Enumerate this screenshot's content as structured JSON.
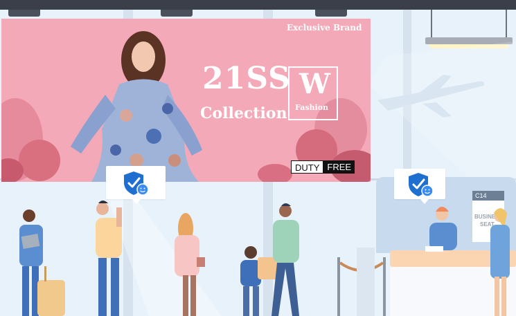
{
  "banner": {
    "brand": "Exclusive Brand",
    "title_line1": "21SS",
    "title_line2": "Collection",
    "logo_letter": "W",
    "logo_sub": "Fashion",
    "duty": "DUTY",
    "free": "FREE"
  },
  "gate": {
    "code": "C14",
    "sign_line1": "BUSINE",
    "sign_line2": "SEAT"
  },
  "icons": {
    "shield": "shield-face-check-icon"
  },
  "colors": {
    "background": "#e7f2fb",
    "banner_pink": "#f3a9b8",
    "shield_blue": "#1f6fd1",
    "counter_peach": "#fbd4b2"
  }
}
